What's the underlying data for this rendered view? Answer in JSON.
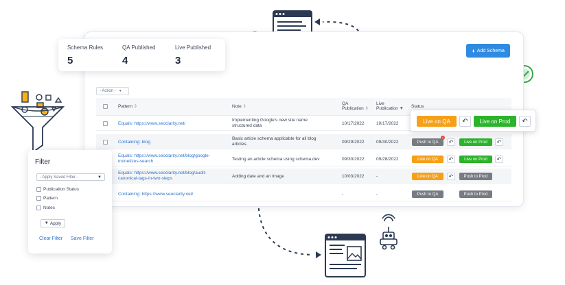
{
  "stats": {
    "schema_rules": {
      "label": "Schema Rules",
      "value": "5"
    },
    "qa_published": {
      "label": "QA Published",
      "value": "4"
    },
    "live_published": {
      "label": "Live Published",
      "value": "3"
    }
  },
  "toolbar": {
    "add_schema_label": "Add Schema",
    "action_select": "- Action -"
  },
  "table": {
    "headers": {
      "pattern": "Pattern",
      "note": "Note",
      "qa_pub_1": "QA",
      "qa_pub_2": "Publication",
      "live_pub_1": "Live",
      "live_pub_2": "Publication",
      "status": "Status"
    },
    "rows": [
      {
        "pattern": "Equals: https://www.seoclarity.net/",
        "pattern_2": "",
        "note": "Implementing Google's new site name",
        "note_2": "structured data",
        "qa_date": "10/17/2022",
        "live_date": "10/17/2022"
      },
      {
        "pattern": "Containing: blog",
        "pattern_2": "",
        "note": "Basic article schema applicable for all blog",
        "note_2": "articles.",
        "qa_date": "09/29/2022",
        "live_date": "09/30/2022",
        "qa_status": "Push to QA",
        "qa_badge": "!",
        "live_status": "Live on Prod"
      },
      {
        "pattern": "Equals: https://www.seoclarity.net/blog/google-",
        "pattern_2": "monetizes-search",
        "note": "Testing an article schema using schema.dev",
        "note_2": "",
        "qa_date": "09/30/2022",
        "live_date": "09/28/2022",
        "qa_status": "Live on QA",
        "live_status": "Live on Prod"
      },
      {
        "pattern": "Equals: https://www.seoclarity.net/blog/audit-",
        "pattern_2": "canonical-tags-in-two-steps",
        "note": "Adding date and an image",
        "note_2": "",
        "qa_date": "10/03/2022",
        "live_date": "-",
        "qa_status": "Live on QA",
        "live_status": "Push to Prod"
      },
      {
        "pattern": "Containing: https://www.seoclarity.net/",
        "pattern_2": "",
        "note": "",
        "note_2": "",
        "qa_date": "-",
        "live_date": "-",
        "qa_status": "Push to QA",
        "live_status": "Push to Prod"
      }
    ]
  },
  "status_popup": {
    "qa_status": "Live on QA",
    "live_status": "Live on Prod"
  },
  "filter": {
    "title": "Filter",
    "saved_filter": "- Apply Saved Filter -",
    "options": [
      "Publication Status",
      "Pattern",
      "Notes"
    ],
    "apply_label": "Apply",
    "clear_label": "Clear Filter",
    "save_label": "Save Filter"
  },
  "colors": {
    "primary": "#2f8ae1",
    "live_qa": "#f6a019",
    "live_prod": "#2bb32b",
    "push": "#777b82",
    "link": "#2c73c9",
    "check_green": "#3aa84a"
  }
}
